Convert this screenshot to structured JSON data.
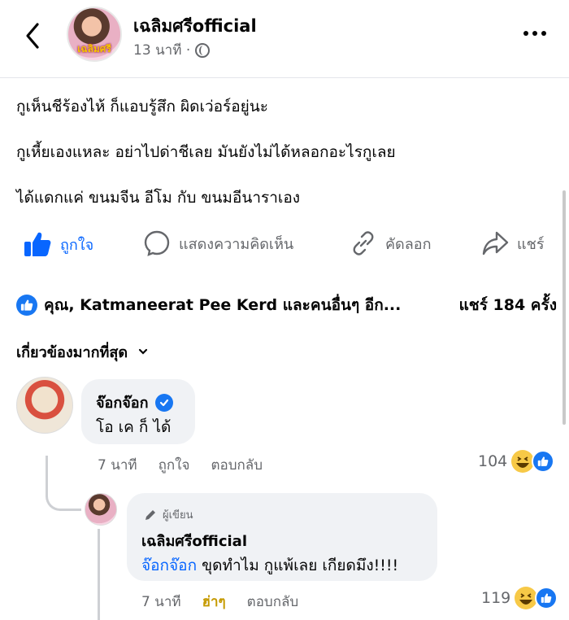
{
  "post": {
    "page_name": "เฉลิมศรีofficial",
    "time": "13 นาที ·",
    "avatar_stamp": "เฉลิมศรี",
    "lines": [
      "กูเห็นชีร้องไห้ ก็แอบรู้สึก ผิดเว่อร์อยู่นะ",
      "กูเหี้ยเองแหละ อย่าไปด่าชีเลย มันยังไม่ได้หลอกอะไรกูเลย",
      "ได้แดกแค่ ขนมจีน อีโม กับ ขนมอีนาราเอง"
    ]
  },
  "actions": {
    "like": "ถูกใจ",
    "comment": "แสดงความคิดเห็น",
    "copy": "คัดลอก",
    "share": "แชร์"
  },
  "reactions": {
    "summary": "คุณ, Katmaneerat Pee Kerd และคนอื่นๆ อีก...",
    "shares": "แชร์ 184 ครั้ง"
  },
  "sort": {
    "label": "เกี่ยวข้องมากที่สุด"
  },
  "comments": [
    {
      "name": "จ๊อกจ๊อก",
      "text": "โอ เค ก็ ได้",
      "time": "7 นาที",
      "like": "ถูกใจ",
      "reply": "ตอบกลับ",
      "count": "104"
    },
    {
      "author_tag": "ผู้เขียน",
      "name": "เฉลิมศรีofficial",
      "mention": "จ๊อกจ๊อก",
      "text": " ขุดทำไม กูแพ้เลย เกียดมึง!!!!",
      "time": "7 นาที",
      "reaction": "ฮ่าๆ",
      "reply": "ตอบกลับ",
      "count": "119",
      "avatar_stamp": "เฉลิมศรี"
    }
  ],
  "colors": {
    "accent": "#0866ff",
    "muted": "#65676b",
    "bubble": "#f0f2f5",
    "haha": "#c59a00"
  },
  "icons": [
    "back-icon",
    "globe-icon",
    "more-icon",
    "like-icon",
    "comment-icon",
    "copy-link-icon",
    "share-icon",
    "verified-icon",
    "haha-emoji-icon",
    "chevron-down-icon",
    "pen-icon"
  ]
}
